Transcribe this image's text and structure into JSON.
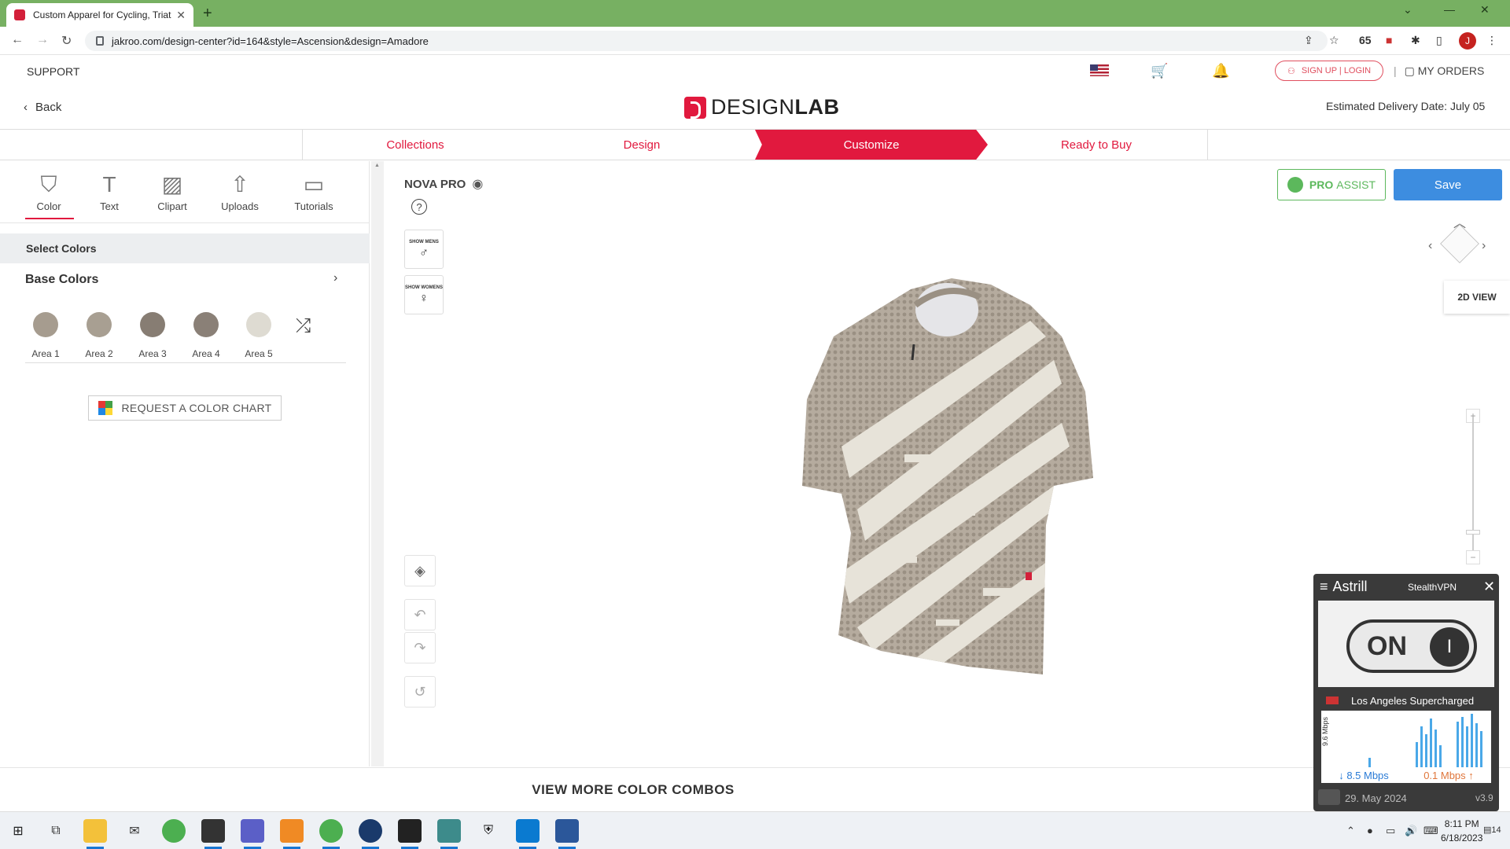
{
  "browser": {
    "tab_title": "Custom Apparel for Cycling, Triat",
    "tab_close": "✕",
    "new_tab": "+",
    "url": "jakroo.com/design-center?id=164&style=Ascension&design=Amadore",
    "badge_count": "65",
    "profile_initial": "J"
  },
  "header": {
    "support": "SUPPORT",
    "signup_login": "SIGN UP | LOGIN",
    "separator": "|",
    "my_orders": "MY ORDERS",
    "back": "Back",
    "logo_design": "DESIGN",
    "logo_lab": "LAB",
    "delivery": "Estimated Delivery Date: July 05"
  },
  "steps": [
    {
      "label": "Collections"
    },
    {
      "label": "Design"
    },
    {
      "label": "Customize"
    },
    {
      "label": "Ready to Buy"
    }
  ],
  "tools": [
    {
      "label": "Color"
    },
    {
      "label": "Text"
    },
    {
      "label": "Clipart"
    },
    {
      "label": "Uploads"
    },
    {
      "label": "Tutorials"
    }
  ],
  "colors_panel": {
    "select_colors": "Select Colors",
    "base_colors": "Base Colors",
    "areas": [
      {
        "label": "Area 1",
        "color": "#a69c8f"
      },
      {
        "label": "Area 2",
        "color": "#a89f92"
      },
      {
        "label": "Area 3",
        "color": "#877d73"
      },
      {
        "label": "Area 4",
        "color": "#8a8077"
      },
      {
        "label": "Area 5",
        "color": "#dedbd2"
      }
    ],
    "request_chart": "REQUEST A COLOR CHART"
  },
  "canvas": {
    "product_name": "NOVA PRO",
    "help": "?",
    "show_mens": "SHOW MENS",
    "show_womens": "SHOW WOMENS",
    "pro_assist_bold": "PRO",
    "pro_assist_light": "ASSIST",
    "save": "Save",
    "view_2d": "2D VIEW",
    "zoom_in": "+",
    "zoom_out": "−"
  },
  "footer": {
    "view_more": "VIEW MORE COLOR COMBOS"
  },
  "astrill": {
    "title": "Astrill",
    "stealth": "StealthVPN",
    "close": "✕",
    "toggle": "ON",
    "knob": "I",
    "server": "Los Angeles Supercharged",
    "graph_max": "9.6 Mbps",
    "down_speed": "8.5 Mbps",
    "up_speed": "0.1 Mbps",
    "date": "29. May 2024",
    "version": "v3.9"
  },
  "taskbar": {
    "time": "8:11 PM",
    "date": "6/18/2023",
    "notification_count": "14"
  },
  "icons": {
    "accent": "#e1193e",
    "save_blue": "#3d8de0",
    "pro_green": "#5cb85c"
  }
}
